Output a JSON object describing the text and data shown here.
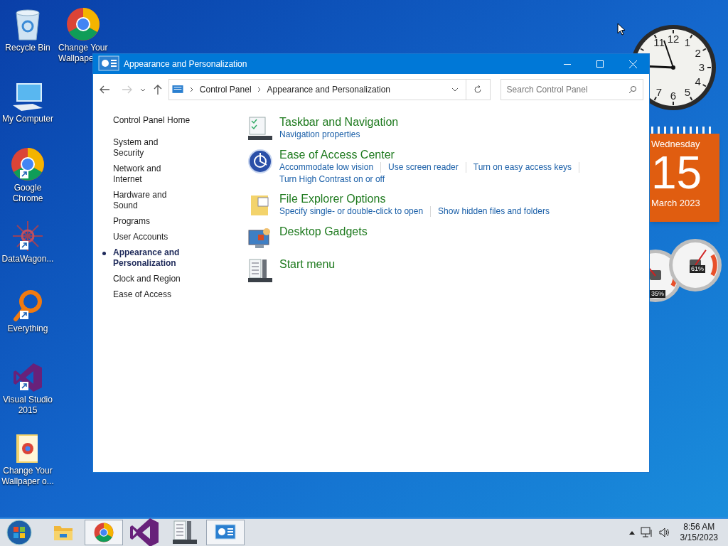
{
  "desktop": {
    "icons": [
      {
        "label": "Recycle Bin",
        "kind": "recycle",
        "shortcut": false
      },
      {
        "label_lines": [
          "Change Your",
          "Wallpape"
        ],
        "kind": "chrome",
        "shortcut": false
      },
      {
        "label": "My Computer",
        "kind": "computer",
        "shortcut": false
      },
      {
        "label": "Google Chrome",
        "kind": "chrome",
        "shortcut": true
      },
      {
        "label": "DataWagon...",
        "kind": "snowflake",
        "shortcut": true
      },
      {
        "label": "Everything",
        "kind": "magnifier",
        "shortcut": true
      },
      {
        "label": "Visual Studio 2015",
        "kind": "vs",
        "shortcut": true
      },
      {
        "label": "Change Your Wallpaper o...",
        "kind": "folder",
        "shortcut": false
      }
    ]
  },
  "gadgets": {
    "clock": {
      "numerals": [
        "11",
        "12",
        "1",
        "2",
        "3",
        "4",
        "7",
        "6",
        "5"
      ]
    },
    "calendar": {
      "weekday": "Wednesday",
      "day": "15",
      "month_year": "March 2023"
    },
    "meters": [
      {
        "reading": "35%"
      },
      {
        "reading": "61%"
      }
    ]
  },
  "window": {
    "title": "Appearance and Personalization",
    "path": [
      "Control Panel",
      "Appearance and Personalization"
    ],
    "search": {
      "placeholder": "Search Control Panel"
    },
    "sidebar": [
      {
        "label": "Control Panel Home",
        "selected": false,
        "kind": "home"
      },
      {
        "label": "System and Security",
        "selected": false,
        "kind": "item"
      },
      {
        "label": "Network and Internet",
        "selected": false,
        "kind": "item"
      },
      {
        "label": "Hardware and Sound",
        "selected": false,
        "kind": "item"
      },
      {
        "label": "Programs",
        "selected": false,
        "kind": "item"
      },
      {
        "label": "User Accounts",
        "selected": false,
        "kind": "item"
      },
      {
        "label": "Appearance and Personalization",
        "selected": true,
        "kind": "item"
      },
      {
        "label": "Clock and Region",
        "selected": false,
        "kind": "item"
      },
      {
        "label": "Ease of Access",
        "selected": false,
        "kind": "item"
      }
    ],
    "categories": [
      {
        "title": "Taskbar and Navigation",
        "kind": "taskbar",
        "links": [
          "Navigation properties"
        ]
      },
      {
        "title": "Ease of Access Center",
        "kind": "access",
        "links": [
          "Accommodate low vision",
          "Use screen reader",
          "Turn on easy access keys",
          "Turn High Contrast on or off"
        ]
      },
      {
        "title": "File Explorer Options",
        "kind": "folder",
        "links": [
          "Specify single- or double-click to open",
          "Show hidden files and folders"
        ]
      },
      {
        "title": "Desktop Gadgets",
        "kind": "gadgets"
      },
      {
        "title": "Start menu",
        "kind": "startmenu"
      }
    ]
  },
  "taskbar": {
    "items": [
      {
        "kind": "explorer",
        "selected": false
      },
      {
        "kind": "chrome",
        "selected": true
      },
      {
        "kind": "vs",
        "selected": false
      },
      {
        "kind": "startmenu",
        "selected": false
      },
      {
        "kind": "controlpanel",
        "selected": true
      }
    ],
    "time": "8:56 AM",
    "date": "3/15/2023"
  }
}
